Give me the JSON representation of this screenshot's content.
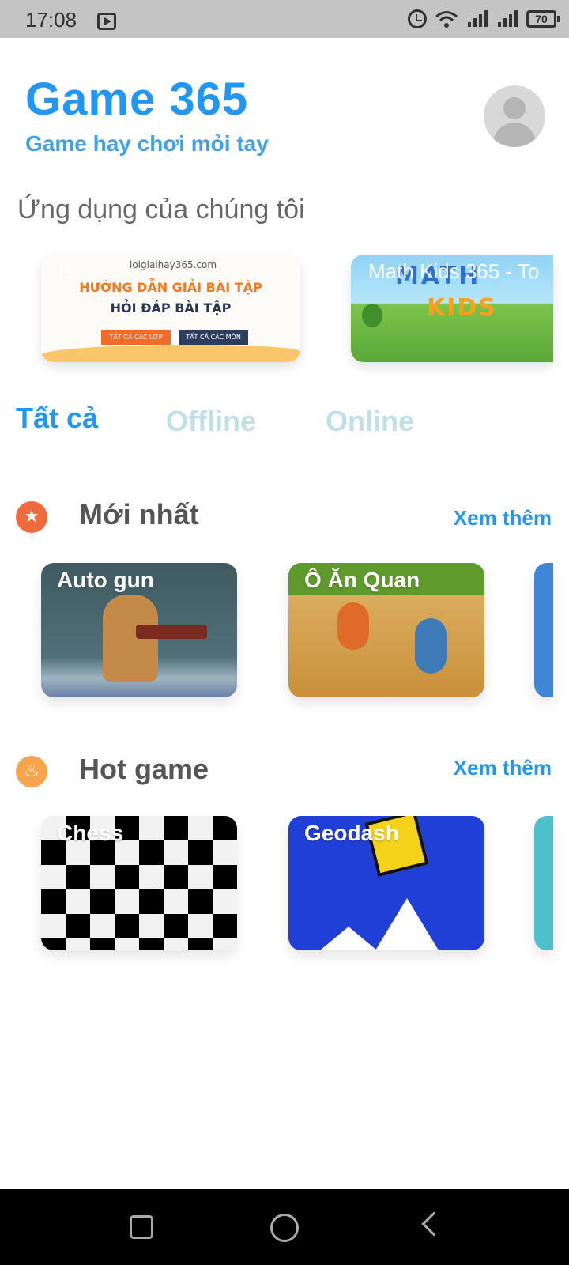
{
  "status_bar": {
    "time": "17:08",
    "battery": "70",
    "icons": [
      "video-icon",
      "alarm-icon",
      "wifi-icon",
      "signal-icon",
      "signal-icon",
      "battery-icon"
    ]
  },
  "header": {
    "title": "Game 365",
    "subtitle": "Game hay chơi mỏi tay"
  },
  "apps_section": {
    "title": "Ứng dụng của chúng tôi",
    "items": [
      {
        "label": "B",
        "logo": "loigiaihay365.com",
        "headline": "HƯỚNG DẪN GIẢI BÀI TẬP",
        "subheadline": "HỎI ĐÁP BÀI TẬP",
        "btn1": "TẤT CẢ CÁC LỚP",
        "btn2": "TẤT CẢ CÁC MÔN"
      },
      {
        "label": "Math Kids 365 - To",
        "art_line1": "MATH",
        "art_line2": "KIDS"
      }
    ]
  },
  "tabs": [
    {
      "label": "Tất cả",
      "active": true
    },
    {
      "label": "Offline",
      "active": false
    },
    {
      "label": "Online",
      "active": false
    }
  ],
  "sections": [
    {
      "title": "Mới nhất",
      "more": "Xem thêm",
      "games": [
        "Auto gun",
        "Ô Ăn Quan"
      ]
    },
    {
      "title": "Hot game",
      "more": "Xem thêm",
      "games": [
        "Chess",
        "Geodash"
      ]
    }
  ],
  "colors": {
    "accent": "#2196f3",
    "tab_inactive": "#bfe0e6",
    "star_icon": "#ef6a3c",
    "fire_icon": "#f5a54c"
  }
}
